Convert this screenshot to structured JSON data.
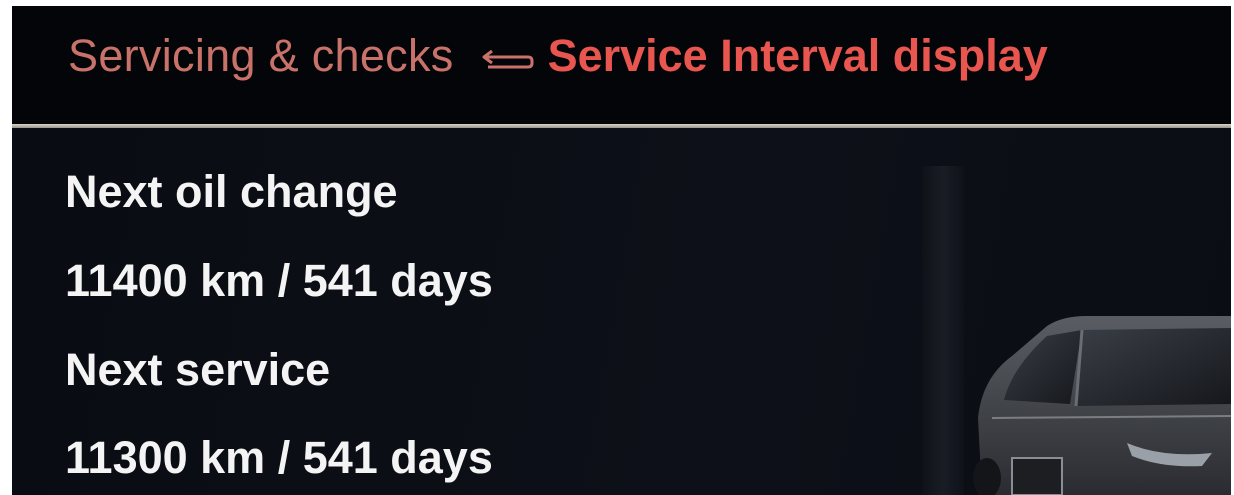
{
  "header": {
    "parent_label": "Servicing & checks",
    "current_label": "Service Interval display",
    "back_icon": "back-arrow-icon"
  },
  "info": {
    "oil_label": "Next oil change",
    "oil_value": "11400 km / 541 days",
    "service_label": "Next service",
    "service_value": "11300 km / 541 days"
  },
  "colors": {
    "parent_text": "#c8726a",
    "current_text": "#e8564f",
    "background": "#07080c",
    "info_text": "#f4f4f4"
  }
}
